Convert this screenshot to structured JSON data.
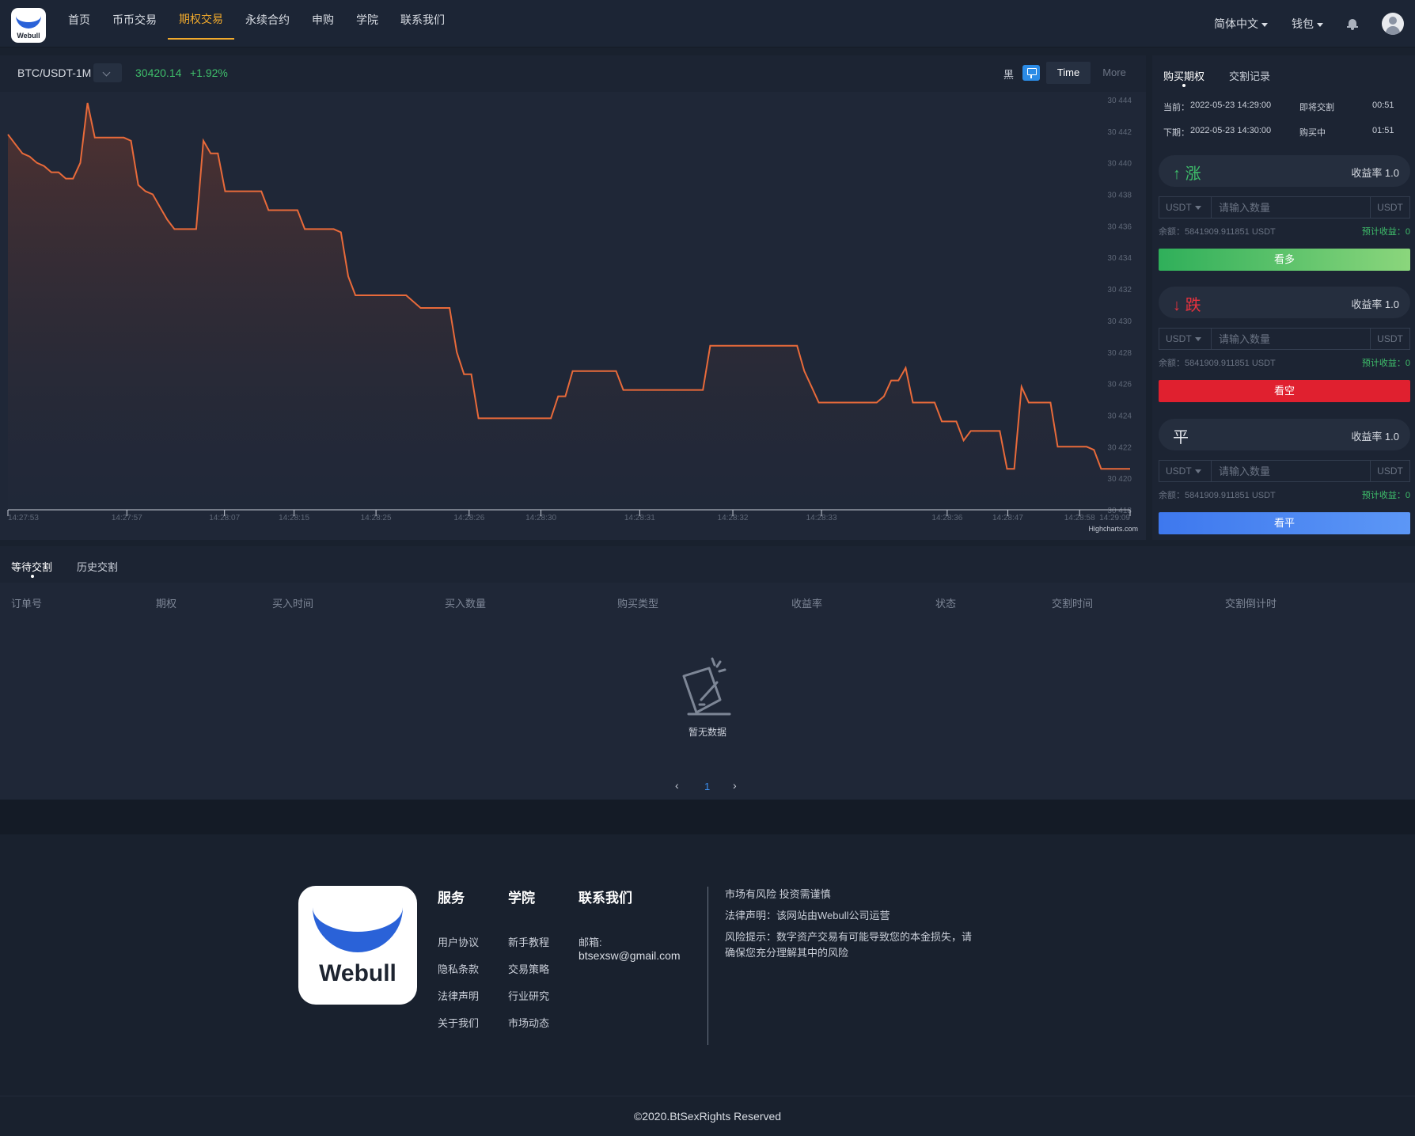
{
  "nav": {
    "logo_text": "Webull",
    "items": [
      "首页",
      "币币交易",
      "期权交易",
      "永续合约",
      "申购",
      "学院",
      "联系我们"
    ],
    "active_index": 2,
    "language": "简体中文",
    "wallet": "钱包"
  },
  "chart_header": {
    "pair": "BTC/USDT-1M",
    "price": "30420.14",
    "change": "+1.92%",
    "theme_label": "黑",
    "time_btn": "Time",
    "more_btn": "More",
    "credit": "Highcharts.com"
  },
  "chart_data": {
    "type": "area",
    "series": [
      {
        "values": [
          30441.8,
          30441.2,
          30440.6,
          30440.4,
          30440.0,
          30439.8,
          30439.4,
          30439.4,
          30439.0,
          30439.0,
          30440.0,
          30443.8,
          30441.6,
          30441.6,
          30441.6,
          30441.6,
          30441.6,
          30441.4,
          30438.6,
          30438.2,
          30438.0,
          30437.2,
          30436.4,
          30435.8,
          30435.8,
          30435.8,
          30435.8,
          30441.4,
          30440.6,
          30440.6,
          30438.2,
          30438.2,
          30438.2,
          30438.2,
          30438.2,
          30438.2,
          30437.0,
          30437.0,
          30437.0,
          30437.0,
          30437.0,
          30435.8,
          30435.8,
          30435.8,
          30435.8,
          30435.8,
          30435.6,
          30432.8,
          30431.6,
          30431.6,
          30431.6,
          30431.6,
          30431.6,
          30431.6,
          30431.6,
          30431.6,
          30431.2,
          30430.8,
          30430.8,
          30430.8,
          30430.8,
          30430.8,
          30428.0,
          30426.6,
          30426.6,
          30423.8,
          30423.8,
          30423.8,
          30423.8,
          30423.8,
          30423.8,
          30423.8,
          30423.8,
          30423.8,
          30423.8,
          30423.8,
          30425.2,
          30425.2,
          30426.8,
          30426.8,
          30426.8,
          30426.8,
          30426.8,
          30426.8,
          30426.8,
          30425.6,
          30425.6,
          30425.6,
          30425.6,
          30425.6,
          30425.6,
          30425.6,
          30425.6,
          30425.6,
          30425.6,
          30425.6,
          30425.6,
          30428.4,
          30428.4,
          30428.4,
          30428.4,
          30428.4,
          30428.4,
          30428.4,
          30428.4,
          30428.4,
          30428.4,
          30428.4,
          30428.4,
          30428.4,
          30426.8,
          30425.8,
          30424.8,
          30424.8,
          30424.8,
          30424.8,
          30424.8,
          30424.8,
          30424.8,
          30424.8,
          30424.8,
          30425.2,
          30426.2,
          30426.2,
          30427.0,
          30424.8,
          30424.8,
          30424.8,
          30424.8,
          30423.6,
          30423.6,
          30423.6,
          30422.4,
          30423.0,
          30423.0,
          30423.0,
          30423.0,
          30423.0,
          30420.6,
          30420.6,
          30425.8,
          30424.8,
          30424.8,
          30424.8,
          30424.8,
          30422.0,
          30422.0,
          30422.0,
          30422.0,
          30422.0,
          30421.8,
          30420.6,
          30420.6,
          30420.6,
          30420.6,
          30420.6
        ]
      }
    ],
    "x_ticks": [
      "14:27:53",
      "14:27:57",
      "14:28:07",
      "14:28:15",
      "14:28:25",
      "14:28:26",
      "14:28:30",
      "14:28:31",
      "14:28:32",
      "14:28:33",
      "14:28:36",
      "14:28:47",
      "14:28:58",
      "14:29:09"
    ],
    "y_ticks": [
      "30 444",
      "30 442",
      "30 440",
      "30 438",
      "30 436",
      "30 434",
      "30 432",
      "30 430",
      "30 428",
      "30 426",
      "30 424",
      "30 422",
      "30 420",
      "30 418"
    ],
    "ylim": [
      30418,
      30444
    ],
    "line_color": "#e86a3a",
    "grid": false
  },
  "side": {
    "tabs": [
      "购买期权",
      "交割记录"
    ],
    "current_label": "当前：",
    "current_time": "2022-05-23 14:29:00",
    "current_status": "即将交割",
    "current_countdown": "00:51",
    "next_label": "下期：",
    "next_time": "2022-05-23 14:30:00",
    "next_status": "购买中",
    "next_countdown": "01:51",
    "directions": [
      {
        "arrow": "↑",
        "label": "涨",
        "rate": "收益率 1.0",
        "button": "看多",
        "color": "#3fbf6b"
      },
      {
        "arrow": "↓",
        "label": "跌",
        "rate": "收益率 1.0",
        "button": "看空",
        "color": "#e8323e"
      },
      {
        "arrow": "",
        "label": "平",
        "rate": "收益率 1.0",
        "button": "看平",
        "color": "#4a86f0"
      }
    ],
    "currency": "USDT",
    "amount_placeholder": "请输入数量",
    "unit": "USDT",
    "balance": "余额：5841909.911851 USDT",
    "estimate": "预计收益：0"
  },
  "orders": {
    "tabs": [
      "等待交割",
      "历史交割"
    ],
    "columns": [
      "订单号",
      "期权",
      "买入时间",
      "买入数量",
      "购买类型",
      "收益率",
      "状态",
      "交割时间",
      "交割倒计时"
    ],
    "empty_text": "暂无数据",
    "page": "1",
    "prev": "‹",
    "next": "›"
  },
  "footer": {
    "logo_text": "Webull",
    "col_service": "服务",
    "col_academy": "学院",
    "col_contact": "联系我们",
    "service_links": [
      "用户协议",
      "隐私条款",
      "法律声明",
      "关于我们"
    ],
    "academy_links": [
      "新手教程",
      "交易策略",
      "行业研究",
      "市场动态"
    ],
    "mail_label": "邮箱:",
    "mail": "btsexsw@gmail.com",
    "notice1": "市场有风险 投资需谨慎",
    "notice2": "法律声明：该网站由Webull公司运营",
    "notice3": "风险提示：数字资产交易有可能导致您的本金损失，请确保您充分理解其中的风险",
    "copyright": "©2020.BtSexRights Reserved"
  }
}
